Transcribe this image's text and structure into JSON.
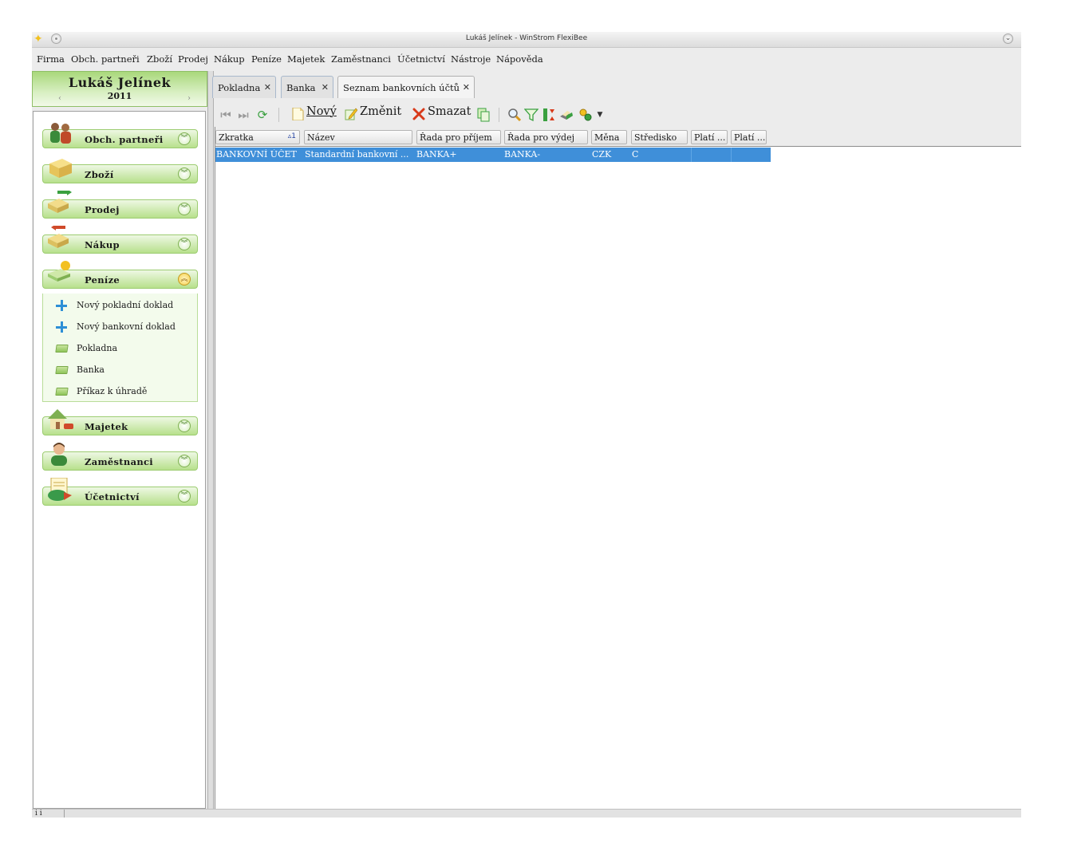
{
  "window": {
    "title": "Lukáš Jelínek - WinStrom FlexiBee"
  },
  "menu": [
    "Firma",
    "Obch. partneři",
    "Zboží",
    "Prodej",
    "Nákup",
    "Peníze",
    "Majetek",
    "Zaměstnanci",
    "Účetnictví",
    "Nástroje",
    "Nápověda"
  ],
  "nav": {
    "user": "Lukáš Jelínek",
    "year": "2011",
    "sections": [
      "Obch. partneři",
      "Zboží",
      "Prodej",
      "Nákup",
      "Peníze",
      "Majetek",
      "Zaměstnanci",
      "Účetnictví"
    ],
    "open_section": "Peníze",
    "subitems": [
      {
        "label": "Nový pokladní doklad",
        "icon": "plus-icon"
      },
      {
        "label": "Nový bankovní doklad",
        "icon": "plus-icon"
      },
      {
        "label": "Pokladna",
        "icon": "folder-icon"
      },
      {
        "label": "Banka",
        "icon": "folder-icon"
      },
      {
        "label": "Příkaz k úhradě",
        "icon": "folder-icon"
      }
    ]
  },
  "tabs": [
    {
      "label": "Pokladna",
      "active": false
    },
    {
      "label": "Banka",
      "active": false
    },
    {
      "label": "Seznam bankovních účtů",
      "active": true
    }
  ],
  "toolbar": {
    "new_label": "Nový",
    "edit_label": "Změnit",
    "delete_label": "Smazat"
  },
  "table": {
    "columns": [
      "Zkratka",
      "Název",
      "Řada pro příjem",
      "Řada pro výdej",
      "Měna",
      "Středisko",
      "Platí ...",
      "Platí ..."
    ],
    "sort_indicator": "▵1",
    "rows": [
      [
        "BANKOVNÍ ÚČET",
        "Standardní bankovní ...",
        "BANKA+",
        "BANKA-",
        "CZK",
        "C",
        "",
        ""
      ]
    ]
  },
  "status": {
    "left": "i i"
  },
  "colors": {
    "selection": "#3f8fd9",
    "nav_green": "#b7e08c",
    "open_chevron": "#f6cf4a"
  }
}
